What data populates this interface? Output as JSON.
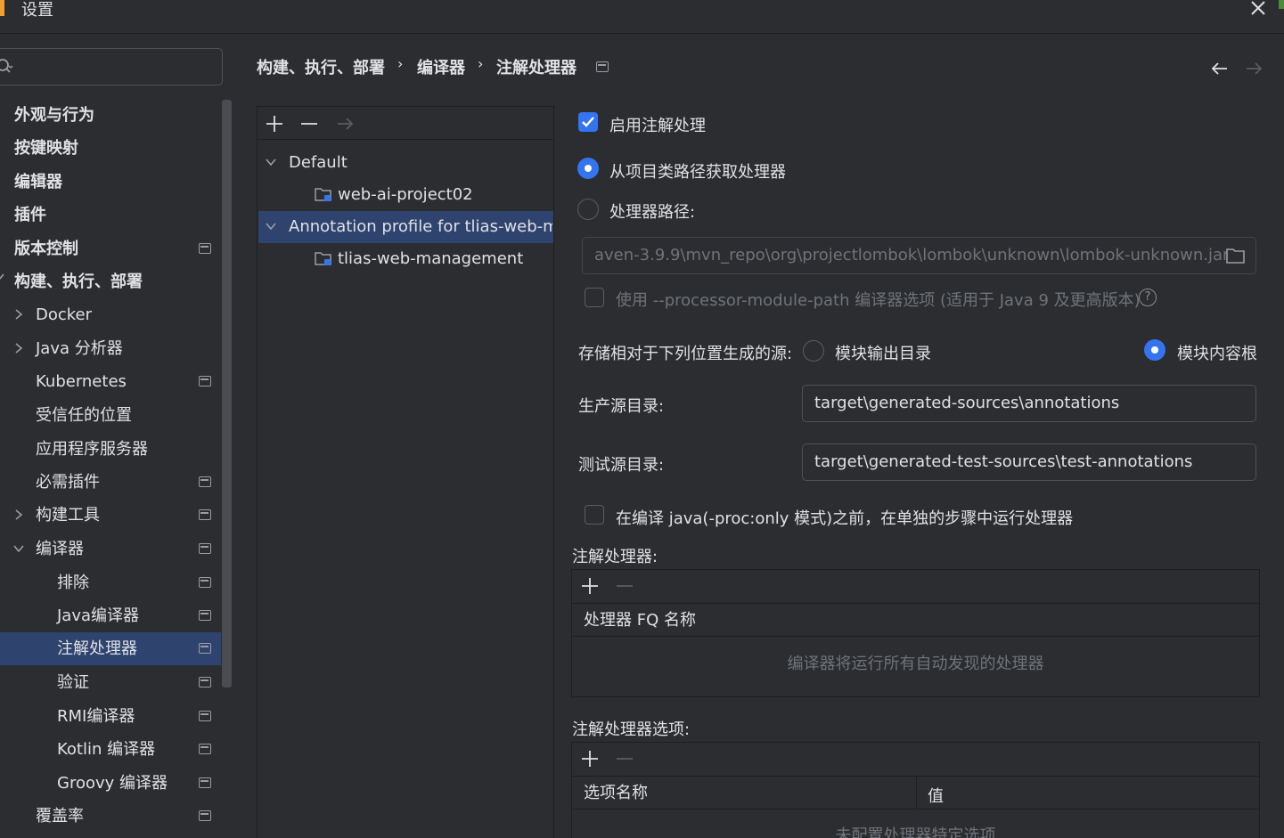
{
  "window": {
    "title": "设置"
  },
  "search": {
    "placeholder": ""
  },
  "sidebar": {
    "items": [
      {
        "label": "外观与行为"
      },
      {
        "label": "按键映射"
      },
      {
        "label": "编辑器"
      },
      {
        "label": "插件"
      },
      {
        "label": "版本控制"
      },
      {
        "label": "构建、执行、部署"
      },
      {
        "label": "Docker"
      },
      {
        "label": "Java 分析器"
      },
      {
        "label": "Kubernetes"
      },
      {
        "label": "受信任的位置"
      },
      {
        "label": "应用程序服务器"
      },
      {
        "label": "必需插件"
      },
      {
        "label": "构建工具"
      },
      {
        "label": "编译器"
      },
      {
        "label": "排除"
      },
      {
        "label": "Java编译器"
      },
      {
        "label": "注解处理器"
      },
      {
        "label": "验证"
      },
      {
        "label": "RMI编译器"
      },
      {
        "label": "Kotlin 编译器"
      },
      {
        "label": "Groovy 编译器"
      },
      {
        "label": "覆盖率"
      }
    ]
  },
  "breadcrumb": {
    "items": [
      "构建、执行、部署",
      "编译器",
      "注解处理器"
    ],
    "separator": "›"
  },
  "profiles": {
    "tree": [
      {
        "label": "Default"
      },
      {
        "label": "web-ai-project02"
      },
      {
        "label": "Annotation profile for tlias-web-m"
      },
      {
        "label": "tlias-web-management"
      }
    ]
  },
  "settings": {
    "enable_label": "启用注解处理",
    "enable_checked": true,
    "from_classpath_label": "从项目类路径获取处理器",
    "processor_path_label": "处理器路径:",
    "processor_path_value": "aven-3.9.9\\mvn_repo\\org\\projectlombok\\lombok\\unknown\\lombok-unknown.jar",
    "module_path_label": "使用 --processor-module-path 编译器选项 (适用于 Java 9 及更高版本)",
    "help_glyph": "?",
    "store_label": "存储相对于下列位置生成的源:",
    "module_output_label": "模块输出目录",
    "module_content_root_label": "模块内容根",
    "prod_dir_label": "生产源目录:",
    "prod_dir_value": "target\\generated-sources\\annotations",
    "test_dir_label": "测试源目录:",
    "test_dir_value": "target\\generated-test-sources\\test-annotations",
    "separate_step_label": "在编译 java(-proc:only 模式)之前，在单独的步骤中运行处理器"
  },
  "processors_table": {
    "title": "注解处理器:",
    "header": "处理器 FQ 名称",
    "empty_text": "编译器将运行所有自动发现的处理器"
  },
  "options_table": {
    "title": "注解处理器选项:",
    "headers": [
      "选项名称",
      "值"
    ],
    "empty_text": "未配置处理器特定选项"
  },
  "colors": {
    "background": "#2b2d30",
    "selection": "#2e436e",
    "accent": "#3574f0",
    "text": "#dfe1e5",
    "disabled_text": "#6f737a"
  }
}
